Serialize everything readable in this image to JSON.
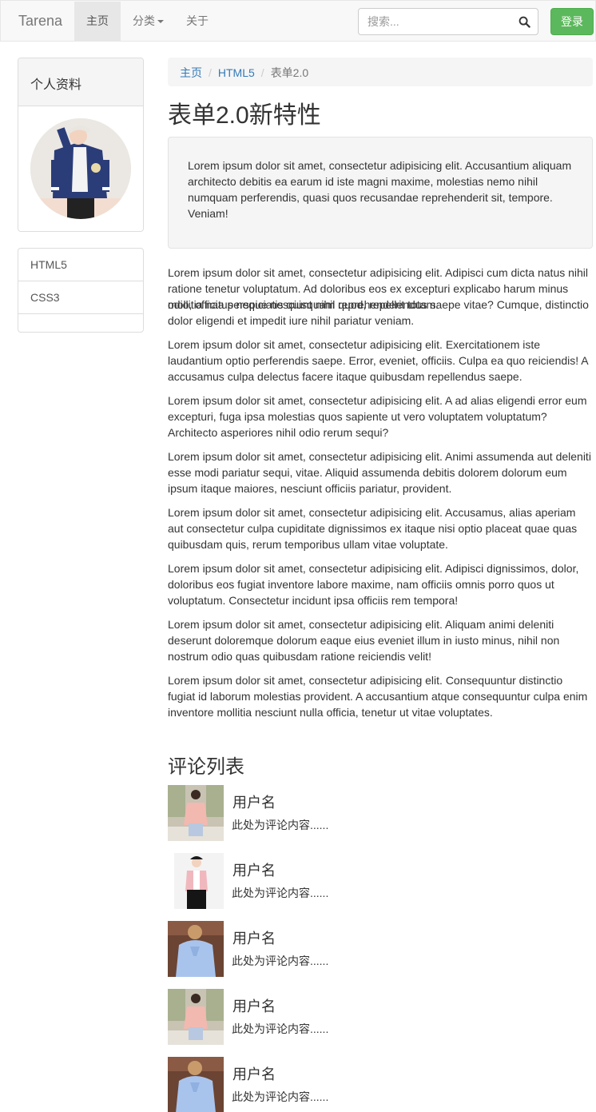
{
  "navbar": {
    "brand": "Tarena",
    "items": [
      {
        "label": "主页",
        "active": true
      },
      {
        "label": "分类",
        "dropdown": true
      },
      {
        "label": "关于"
      }
    ],
    "search_placeholder": "搜索...",
    "search_icon": "search-icon",
    "login_label": "登录",
    "login_color": "#5cb85c"
  },
  "sidebar": {
    "profile_heading": "个人资料",
    "list": [
      {
        "label": "HTML5"
      },
      {
        "label": "CSS3"
      }
    ]
  },
  "breadcrumb": {
    "items": [
      "主页",
      "HTML5"
    ],
    "current": "表单2.0",
    "link_color": "#337ab7"
  },
  "main": {
    "title": "表单2.0新特性",
    "well_text": "Lorem ipsum dolor sit amet, consectetur adipisicing elit. Accusantium aliquam architecto debitis ea earum id iste magni maxime, molestias nemo nihil numquam perferendis, quasi quos recusandae reprehenderit sit, tempore. Veniam!",
    "paragraphs": [
      "Lorem ipsum dolor sit amet, consectetur adipisicing elit. Adipisci cum dicta natus nihil ratione tenetur voluptatum. Ad doloribus eos ex excepturi explicabo harum minus odio, officia perspiciatis quisquam reprehenderit totam.",
      "mollitia natus neque nesciunt nihil quod, repellendus saepe vitae? Cumque, distinctio dolor eligendi et impedit iure nihil pariatur veniam.",
      "Lorem ipsum dolor sit amet, consectetur adipisicing elit. Exercitationem iste laudantium optio perferendis saepe. Error, eveniet, officiis. Culpa ea quo reiciendis! A accusamus culpa delectus facere itaque quibusdam repellendus saepe.",
      "Lorem ipsum dolor sit amet, consectetur adipisicing elit. A ad alias eligendi error eum excepturi, fuga ipsa molestias quos sapiente ut vero voluptatem voluptatum? Architecto asperiores nihil odio rerum sequi?",
      "Lorem ipsum dolor sit amet, consectetur adipisicing elit. Animi assumenda aut deleniti esse modi pariatur sequi, vitae. Aliquid assumenda debitis dolorem dolorum eum ipsum itaque maiores, nesciunt officiis pariatur, provident.",
      "Lorem ipsum dolor sit amet, consectetur adipisicing elit. Accusamus, alias aperiam aut consectetur culpa cupiditate dignissimos ex itaque nisi optio placeat quae quas quibusdam quis, rerum temporibus ullam vitae voluptate.",
      "Lorem ipsum dolor sit amet, consectetur adipisicing elit. Adipisci dignissimos, dolor, doloribus eos fugiat inventore labore maxime, nam officiis omnis porro quos ut voluptatum. Consectetur incidunt ipsa officiis rem tempora!",
      "Lorem ipsum dolor sit amet, consectetur adipisicing elit. Aliquam animi deleniti deserunt doloremque dolorum eaque eius eveniet illum in iusto minus, nihil non nostrum odio quas quibusdam ratione reiciendis velit!",
      "Lorem ipsum dolor sit amet, consectetur adipisicing elit. Consequuntur distinctio fugiat id laborum molestias provident. A accusantium atque consequuntur culpa enim inventore mollitia nesciunt nulla officia, tenetur ut vitae voluptates."
    ]
  },
  "comments": {
    "title": "评论列表",
    "items": [
      {
        "user": "用户名",
        "text": "此处为评论内容......",
        "photo": "pink-jacket"
      },
      {
        "user": "用户名",
        "text": "此处为评论内容......",
        "photo": "cap-jacket"
      },
      {
        "user": "用户名",
        "text": "此处为评论内容......",
        "photo": "blue-blouse"
      },
      {
        "user": "用户名",
        "text": "此处为评论内容......",
        "photo": "pink-jacket"
      },
      {
        "user": "用户名",
        "text": "此处为评论内容......",
        "photo": "blue-blouse"
      }
    ]
  }
}
